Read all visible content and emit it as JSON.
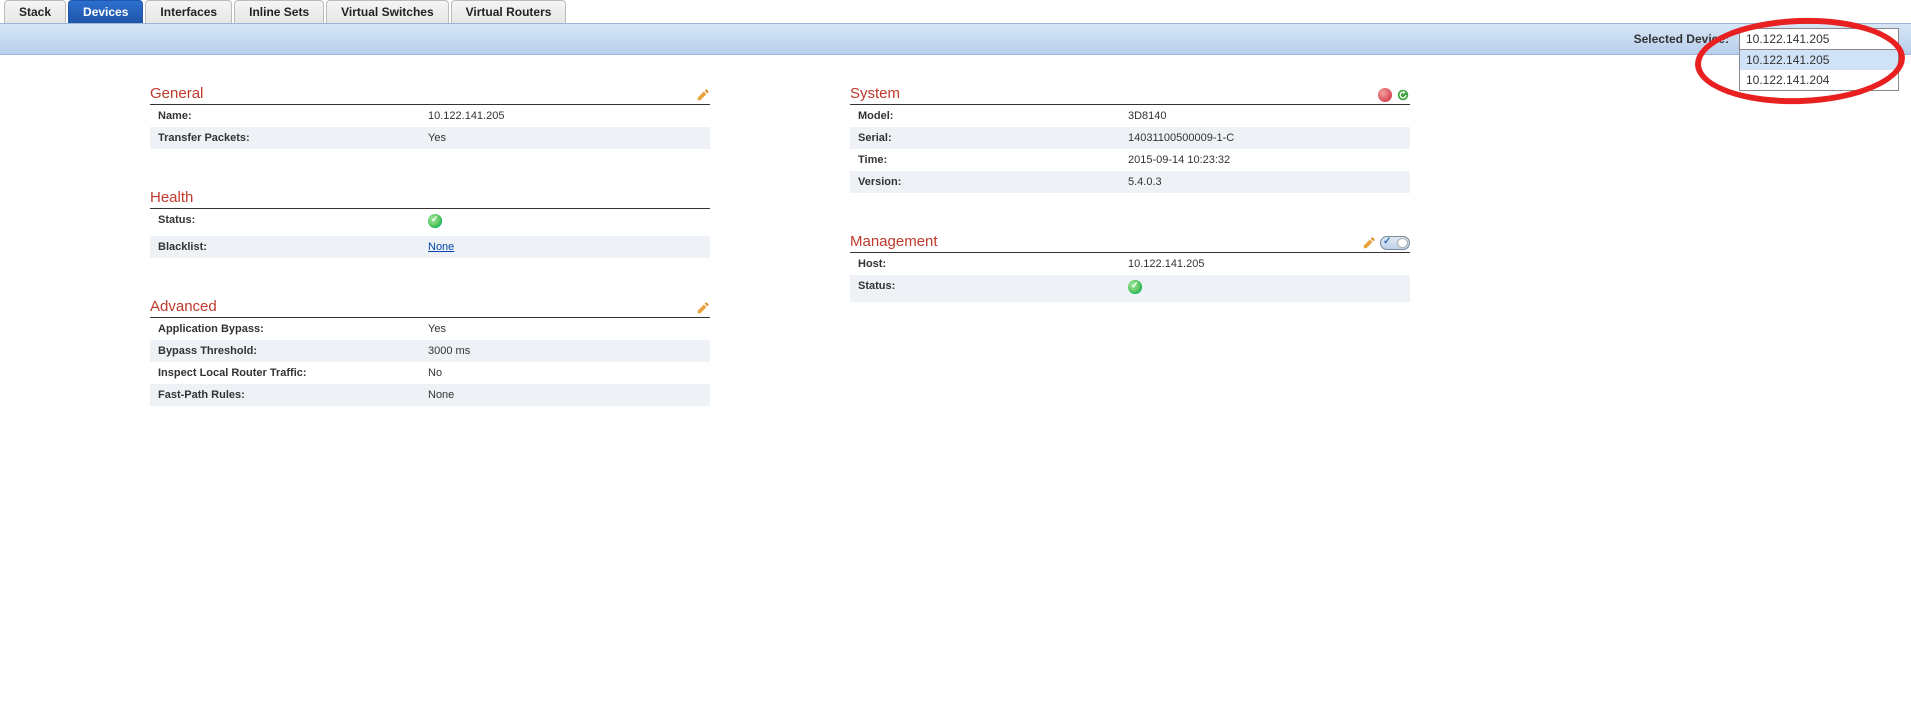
{
  "tabs": [
    {
      "label": "Stack",
      "active": false
    },
    {
      "label": "Devices",
      "active": true
    },
    {
      "label": "Interfaces",
      "active": false
    },
    {
      "label": "Inline Sets",
      "active": false
    },
    {
      "label": "Virtual Switches",
      "active": false
    },
    {
      "label": "Virtual Routers",
      "active": false
    }
  ],
  "selector": {
    "label": "Selected Device:",
    "value": "10.122.141.205",
    "options": [
      "10.122.141.205",
      "10.122.141.204"
    ]
  },
  "sections": {
    "general": {
      "title": "General",
      "rows": [
        {
          "label": "Name:",
          "value": "10.122.141.205"
        },
        {
          "label": "Transfer Packets:",
          "value": "Yes"
        }
      ]
    },
    "health": {
      "title": "Health",
      "rows": [
        {
          "label": "Status:",
          "value": "",
          "status": "green"
        },
        {
          "label": "Blacklist:",
          "value": "None",
          "link": true
        }
      ]
    },
    "advanced": {
      "title": "Advanced",
      "rows": [
        {
          "label": "Application Bypass:",
          "value": "Yes"
        },
        {
          "label": "Bypass Threshold:",
          "value": "3000 ms"
        },
        {
          "label": "Inspect Local Router Traffic:",
          "value": "No"
        },
        {
          "label": "Fast-Path Rules:",
          "value": "None"
        }
      ]
    },
    "system": {
      "title": "System",
      "rows": [
        {
          "label": "Model:",
          "value": "3D8140"
        },
        {
          "label": "Serial:",
          "value": "14031100500009-1-C"
        },
        {
          "label": "Time:",
          "value": "2015-09-14 10:23:32"
        },
        {
          "label": "Version:",
          "value": "5.4.0.3"
        }
      ]
    },
    "management": {
      "title": "Management",
      "rows": [
        {
          "label": "Host:",
          "value": "10.122.141.205"
        },
        {
          "label": "Status:",
          "value": "",
          "status": "green"
        }
      ]
    }
  }
}
